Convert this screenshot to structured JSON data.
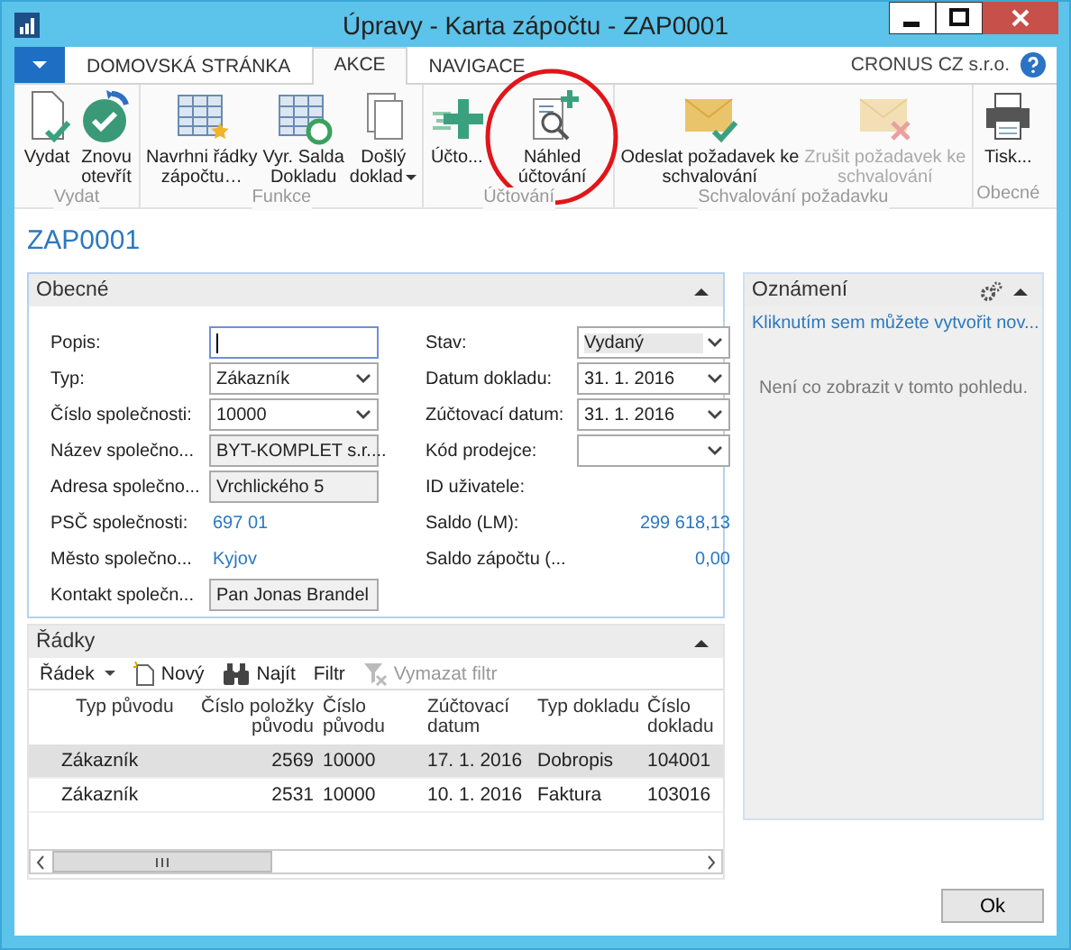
{
  "window": {
    "title": "Úpravy - Karta zápočtu - ZAP0001"
  },
  "tabs": [
    {
      "label": "DOMOVSKÁ STRÁNKA",
      "selected": false
    },
    {
      "label": "AKCE",
      "selected": true
    },
    {
      "label": "NAVIGACE",
      "selected": false
    }
  ],
  "company": "CRONUS CZ s.r.o.",
  "ribbon_groups": [
    {
      "label": "Vydat",
      "buttons": [
        {
          "kind": "release",
          "lines": [
            "Vydat"
          ],
          "disabled": false,
          "dropdown": false
        },
        {
          "kind": "reopen",
          "lines": [
            "Znovu",
            "otevřít"
          ],
          "disabled": false,
          "dropdown": false
        }
      ]
    },
    {
      "label": "Funkce",
      "buttons": [
        {
          "kind": "suggest",
          "lines": [
            "Navrhni řádky",
            "zápočtu…"
          ],
          "disabled": false,
          "dropdown": false
        },
        {
          "kind": "apply",
          "lines": [
            "Vyr. Salda",
            "Dokladu"
          ],
          "disabled": false,
          "dropdown": false
        },
        {
          "kind": "documents",
          "lines": [
            "Došlý",
            "doklad"
          ],
          "disabled": false,
          "dropdown": true
        }
      ]
    },
    {
      "label": "Účtování",
      "buttons": [
        {
          "kind": "post",
          "lines": [
            "Účto..."
          ],
          "disabled": false,
          "dropdown": false
        },
        {
          "kind": "preview",
          "lines": [
            "Náhled",
            "účtování"
          ],
          "disabled": false,
          "dropdown": false
        }
      ]
    },
    {
      "label": "Schvalování požadavku",
      "buttons": [
        {
          "kind": "send",
          "lines": [
            "Odeslat požadavek ke",
            "schvalování"
          ],
          "disabled": false,
          "dropdown": false
        },
        {
          "kind": "cancel",
          "lines": [
            "Zrušit požadavek ke",
            "schvalování"
          ],
          "disabled": true,
          "dropdown": false
        }
      ]
    },
    {
      "label": "Obecné",
      "buttons": [
        {
          "kind": "print",
          "lines": [
            "Tisk..."
          ],
          "disabled": false,
          "dropdown": false
        }
      ]
    }
  ],
  "highlight": {
    "kind": "circle"
  },
  "page_title": "ZAP0001",
  "general": {
    "title": "Obecné",
    "left_fields": [
      {
        "label": "Popis:",
        "kind": "input",
        "focused": true
      },
      {
        "label": "Typ:",
        "kind": "dropdown",
        "value": "Zákazník",
        "focused": false
      },
      {
        "label": "Číslo společnosti:",
        "kind": "dropdown",
        "value": "10000",
        "focused": false
      },
      {
        "label": "Název společno...",
        "kind": "readonly",
        "value": "BYT-KOMPLET s.r....",
        "focused": false
      },
      {
        "label": "Adresa společno...",
        "kind": "readonly",
        "value": "Vrchlického 5",
        "focused": false
      },
      {
        "label": "PSČ společnosti:",
        "kind": "link",
        "value": "697 01"
      },
      {
        "label": "Město společno...",
        "kind": "link",
        "value": "Kyjov"
      },
      {
        "label": "Kontakt společn...",
        "kind": "readonly",
        "value": "Pan Jonas Brandel",
        "focused": false
      }
    ],
    "right_fields": [
      {
        "label": "Stav:",
        "kind": "dropdown-locked",
        "value": "Vydaný",
        "focused": false
      },
      {
        "label": "Datum dokladu:",
        "kind": "dropdown",
        "value": "31. 1. 2016",
        "focused": false
      },
      {
        "label": "Zúčtovací datum:",
        "kind": "dropdown",
        "value": "31. 1. 2016",
        "focused": false
      },
      {
        "label": "Kód prodejce:",
        "kind": "dropdown",
        "focused": false
      },
      {
        "label": "ID uživatele:",
        "kind": "text"
      },
      {
        "label": "Saldo (LM):",
        "kind": "amount",
        "value": "299 618,13"
      },
      {
        "label": "Saldo zápočtu (...",
        "kind": "amount",
        "value": "0,00"
      }
    ]
  },
  "lines": {
    "title": "Řádky",
    "toolbar": [
      {
        "kind": "menu",
        "label": "Řádek",
        "disabled": false
      },
      {
        "kind": "new",
        "label": "Nový",
        "disabled": false
      },
      {
        "kind": "find",
        "label": "Najít",
        "disabled": false
      },
      {
        "kind": "plain",
        "label": "Filtr",
        "disabled": false
      },
      {
        "kind": "clear-filter",
        "label": "Vymazat filtr",
        "disabled": true
      }
    ],
    "columns": [
      "Typ původu",
      "Číslo položky původu",
      "Číslo původu",
      "Zúčtovací datum",
      "Typ dokladu",
      "Číslo dokladu"
    ],
    "rows": [
      {
        "selected": true,
        "cells": [
          "Zákazník",
          "2569",
          "10000",
          "17. 1. 2016",
          "Dobropis",
          "104001"
        ]
      },
      {
        "selected": false,
        "cells": [
          "Zákazník",
          "2531",
          "10000",
          "10. 1. 2016",
          "Faktura",
          "103016"
        ]
      }
    ]
  },
  "notifications": {
    "title": "Oznámení",
    "link": "Kliknutím sem můžete vytvořit nov...",
    "empty": "Není co zobrazit v tomto pohledu."
  },
  "buttons": [
    "Ok"
  ]
}
